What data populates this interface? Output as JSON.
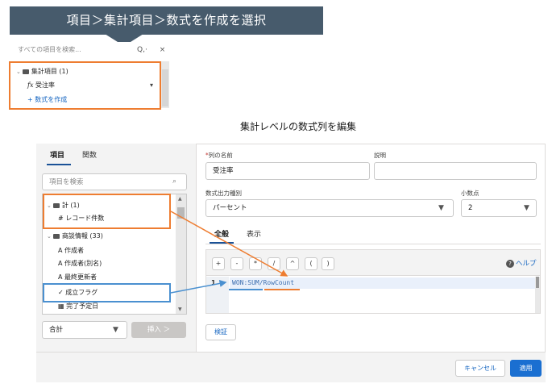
{
  "banner": {
    "text": "項目＞集計項目＞数式を作成を選択"
  },
  "top_panel": {
    "search_placeholder": "すべての項目を検索...",
    "search_icon": "Q,·",
    "close": "×",
    "group_label": "集計項目 (1)",
    "item_label": "受注率",
    "item_prefix": "fx",
    "item_caret": "▾",
    "create_formula": "+ 数式を作成"
  },
  "modal": {
    "title": "集計レベルの数式列を編集",
    "left": {
      "tabs": [
        "項目",
        "関数"
      ],
      "search_placeholder": "項目を検索",
      "tree": [
        {
          "kind": "group",
          "label": "計 (1)"
        },
        {
          "kind": "item",
          "prefix": "#",
          "label": "レコード件数"
        },
        {
          "kind": "group",
          "label": "商談情報 (33)"
        },
        {
          "kind": "item",
          "prefix": "A",
          "label": "作成者"
        },
        {
          "kind": "item",
          "prefix": "A",
          "label": "作成者(別名)"
        },
        {
          "kind": "item",
          "prefix": "A",
          "label": "最終更新者"
        },
        {
          "kind": "item",
          "prefix": "✓",
          "label": "成立フラグ"
        },
        {
          "kind": "item",
          "prefix": "▦",
          "label": "完了予定日"
        }
      ],
      "aggregate_value": "合計",
      "insert_label": "挿入 ＞"
    },
    "right": {
      "col_name_label": "列の名前",
      "required_mark": "*",
      "col_name_value": "受注率",
      "description_label": "説明",
      "description_value": "",
      "output_type_label": "数式出力種別",
      "output_type_value": "パーセント",
      "decimal_label": "小数点",
      "decimal_value": "2",
      "tabs": [
        "全般",
        "表示"
      ],
      "operators": [
        "+",
        "-",
        "*",
        "/",
        "^",
        "(",
        ")"
      ],
      "help_label": "ヘルプ",
      "line_number": "1",
      "formula": "WON:SUM/RowCount",
      "validate_label": "検証"
    },
    "footer": {
      "cancel_label": "キャンセル",
      "apply_label": "適用"
    }
  },
  "colors": {
    "banner": "#475b6c",
    "highlight_orange": "#ee7d31",
    "highlight_blue": "#4a90d0",
    "brand_blue": "#1a6fd1"
  }
}
